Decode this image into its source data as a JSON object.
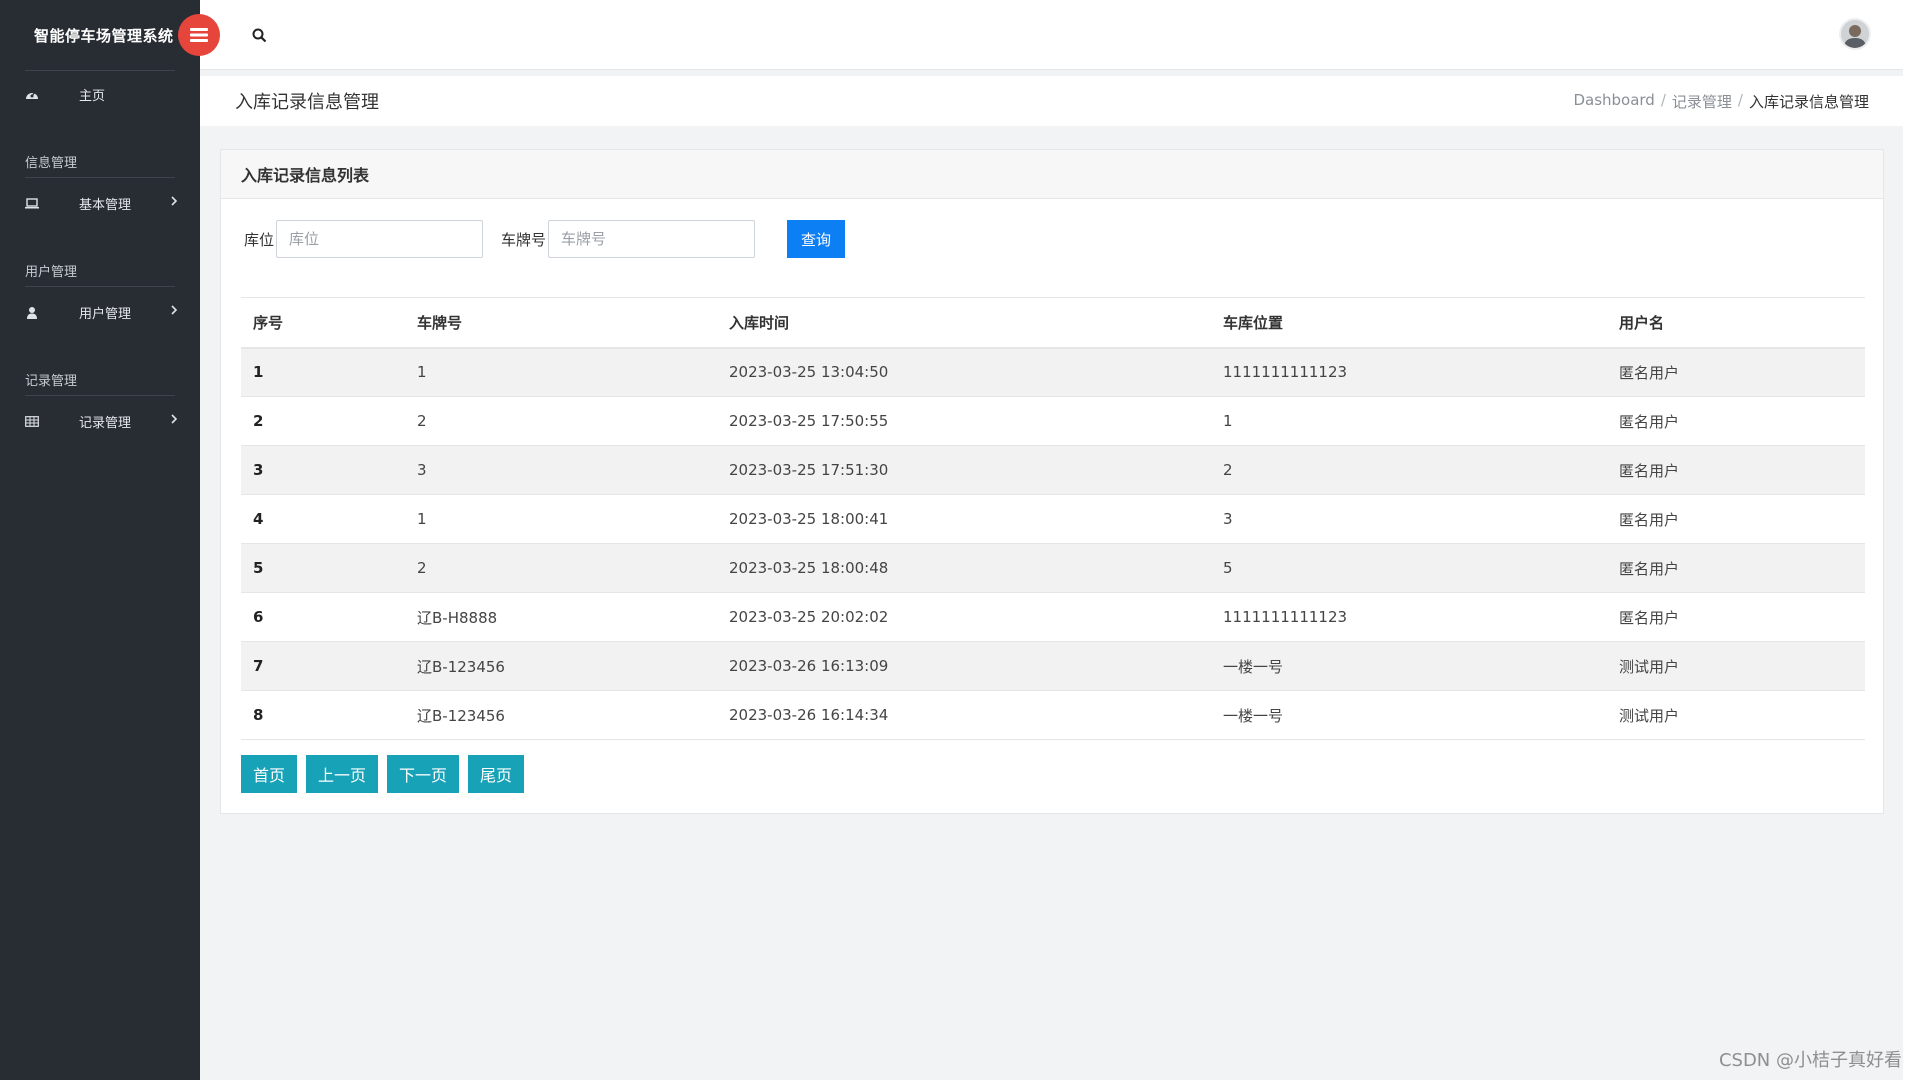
{
  "app": {
    "title": "智能停车场管理系统"
  },
  "sidebar": {
    "home_label": "主页",
    "sections": [
      {
        "heading": "信息管理",
        "item": "基本管理"
      },
      {
        "heading": "用户管理",
        "item": "用户管理"
      },
      {
        "heading": "记录管理",
        "item": "记录管理"
      }
    ]
  },
  "page": {
    "title": "入库记录信息管理",
    "breadcrumb": [
      "Dashboard",
      "记录管理",
      "入库记录信息管理"
    ]
  },
  "card": {
    "title": "入库记录信息列表"
  },
  "filters": {
    "slot_label": "库位",
    "slot_placeholder": "库位",
    "plate_label": "车牌号",
    "plate_placeholder": "车牌号",
    "query_label": "查询"
  },
  "table": {
    "columns": [
      "序号",
      "车牌号",
      "入库时间",
      "车库位置",
      "用户名"
    ],
    "rows": [
      [
        "1",
        "1",
        "2023-03-25 13:04:50",
        "1111111111123",
        "匿名用户"
      ],
      [
        "2",
        "2",
        "2023-03-25 17:50:55",
        "1",
        "匿名用户"
      ],
      [
        "3",
        "3",
        "2023-03-25 17:51:30",
        "2",
        "匿名用户"
      ],
      [
        "4",
        "1",
        "2023-03-25 18:00:41",
        "3",
        "匿名用户"
      ],
      [
        "5",
        "2",
        "2023-03-25 18:00:48",
        "5",
        "匿名用户"
      ],
      [
        "6",
        "辽B-H8888",
        "2023-03-25 20:02:02",
        "1111111111123",
        "匿名用户"
      ],
      [
        "7",
        "辽B-123456",
        "2023-03-26 16:13:09",
        "一楼一号",
        "测试用户"
      ],
      [
        "8",
        "辽B-123456",
        "2023-03-26 16:14:34",
        "一楼一号",
        "测试用户"
      ]
    ]
  },
  "pager": {
    "first": "首页",
    "prev": "上一页",
    "next": "下一页",
    "last": "尾页"
  },
  "watermark": "CSDN @小桔子真好看",
  "colors": {
    "sidebar": "#282c33",
    "primary": "#0d7ff5",
    "pager": "#17a2b8",
    "toggle": "#e5453b"
  }
}
